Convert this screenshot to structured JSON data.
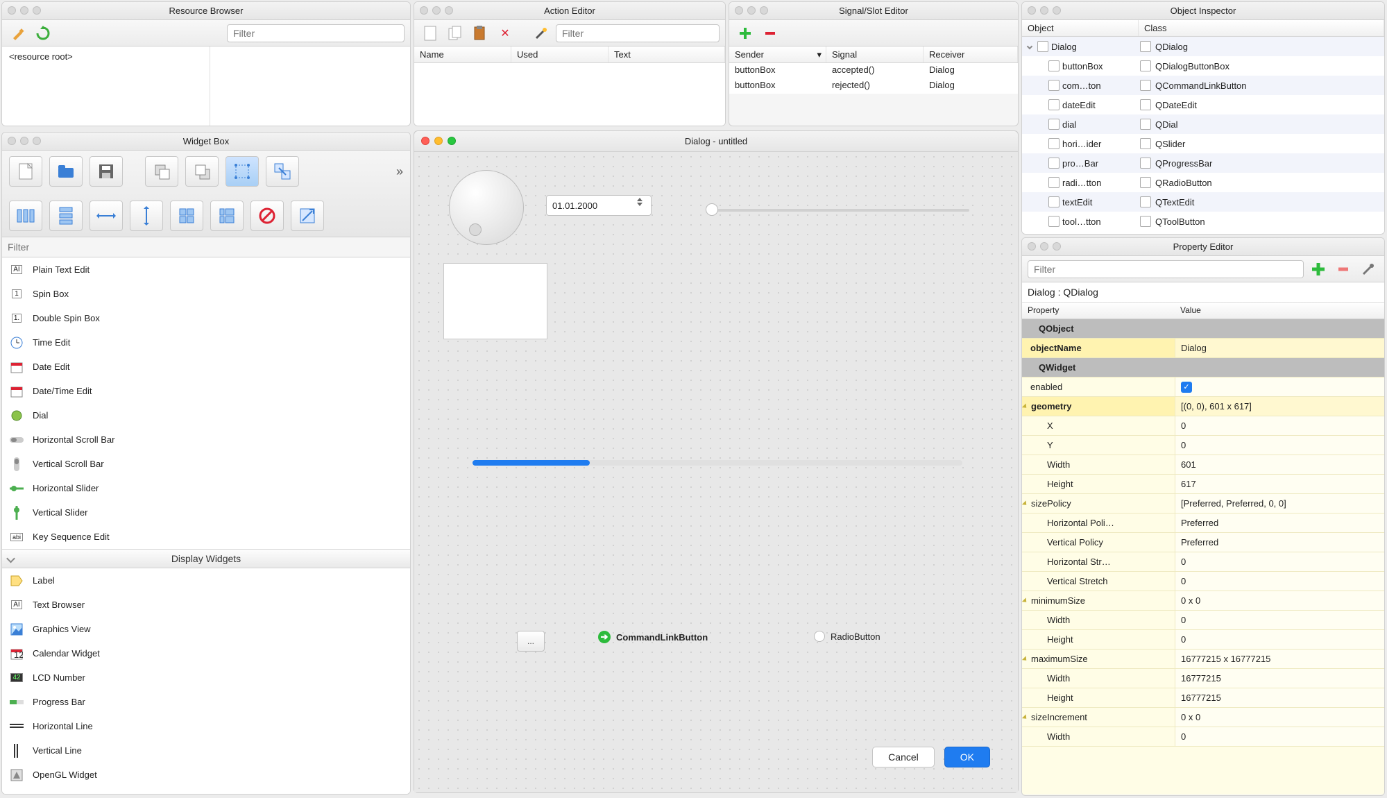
{
  "resourceBrowser": {
    "title": "Resource Browser",
    "filterPlaceholder": "Filter",
    "root": "<resource root>"
  },
  "widgetBox": {
    "title": "Widget Box",
    "filterPlaceholder": "Filter",
    "items": [
      {
        "icon": "[AI]",
        "label": "Plain Text Edit"
      },
      {
        "icon": "[1]",
        "label": "Spin Box"
      },
      {
        "icon": "[1.]",
        "label": "Double Spin Box"
      },
      {
        "icon": "clock",
        "label": "Time Edit"
      },
      {
        "icon": "cal",
        "label": "Date Edit"
      },
      {
        "icon": "cal",
        "label": "Date/Time Edit"
      },
      {
        "icon": "dial",
        "label": "Dial"
      },
      {
        "icon": "hscroll",
        "label": "Horizontal Scroll Bar"
      },
      {
        "icon": "vscroll",
        "label": "Vertical Scroll Bar"
      },
      {
        "icon": "hslider",
        "label": "Horizontal Slider"
      },
      {
        "icon": "vslider",
        "label": "Vertical Slider"
      },
      {
        "icon": "key",
        "label": "Key Sequence Edit"
      }
    ],
    "section2": "Display Widgets",
    "items2": [
      {
        "icon": "label",
        "label": "Label"
      },
      {
        "icon": "[AI]",
        "label": "Text Browser"
      },
      {
        "icon": "gfx",
        "label": "Graphics View"
      },
      {
        "icon": "cal12",
        "label": "Calendar Widget"
      },
      {
        "icon": "lcd",
        "label": "LCD Number"
      },
      {
        "icon": "prog",
        "label": "Progress Bar"
      },
      {
        "icon": "hline",
        "label": "Horizontal Line"
      },
      {
        "icon": "vline",
        "label": "Vertical Line"
      },
      {
        "icon": "ogl",
        "label": "OpenGL Widget"
      }
    ]
  },
  "actionEditor": {
    "title": "Action Editor",
    "filterPlaceholder": "Filter",
    "cols": [
      "Name",
      "Used",
      "Text"
    ]
  },
  "signalEditor": {
    "title": "Signal/Slot Editor",
    "cols": [
      "Sender",
      "Signal",
      "Receiver"
    ],
    "rows": [
      {
        "sender": "buttonBox",
        "signal": "accepted()",
        "receiver": "Dialog"
      },
      {
        "sender": "buttonBox",
        "signal": "rejected()",
        "receiver": "Dialog"
      }
    ]
  },
  "objectInspector": {
    "title": "Object Inspector",
    "cols": [
      "Object",
      "Class"
    ],
    "tree": [
      {
        "indent": 0,
        "object": "Dialog",
        "class": "QDialog",
        "expand": true
      },
      {
        "indent": 1,
        "object": "buttonBox",
        "class": "QDialogButtonBox"
      },
      {
        "indent": 1,
        "object": "com…ton",
        "class": "QCommandLinkButton"
      },
      {
        "indent": 1,
        "object": "dateEdit",
        "class": "QDateEdit"
      },
      {
        "indent": 1,
        "object": "dial",
        "class": "QDial"
      },
      {
        "indent": 1,
        "object": "hori…ider",
        "class": "QSlider"
      },
      {
        "indent": 1,
        "object": "pro…Bar",
        "class": "QProgressBar"
      },
      {
        "indent": 1,
        "object": "radi…tton",
        "class": "QRadioButton"
      },
      {
        "indent": 1,
        "object": "textEdit",
        "class": "QTextEdit"
      },
      {
        "indent": 1,
        "object": "tool…tton",
        "class": "QToolButton"
      }
    ]
  },
  "propertyEditor": {
    "title": "Property Editor",
    "filterPlaceholder": "Filter",
    "context": "Dialog : QDialog",
    "cols": [
      "Property",
      "Value"
    ],
    "rows": [
      {
        "type": "group",
        "name": "QObject"
      },
      {
        "name": "objectName",
        "value": "Dialog",
        "bold": true,
        "edited": true
      },
      {
        "type": "group",
        "name": "QWidget"
      },
      {
        "name": "enabled",
        "value": "check"
      },
      {
        "name": "geometry",
        "value": "[(0, 0), 601 x 617]",
        "bold": true,
        "exp": true,
        "edited": true
      },
      {
        "name": "X",
        "value": "0",
        "child": true
      },
      {
        "name": "Y",
        "value": "0",
        "child": true
      },
      {
        "name": "Width",
        "value": "601",
        "child": true
      },
      {
        "name": "Height",
        "value": "617",
        "child": true
      },
      {
        "name": "sizePolicy",
        "value": "[Preferred, Preferred, 0, 0]",
        "exp": true
      },
      {
        "name": "Horizontal Poli…",
        "value": "Preferred",
        "child": true
      },
      {
        "name": "Vertical Policy",
        "value": "Preferred",
        "child": true
      },
      {
        "name": "Horizontal Str…",
        "value": "0",
        "child": true
      },
      {
        "name": "Vertical Stretch",
        "value": "0",
        "child": true
      },
      {
        "name": "minimumSize",
        "value": "0 x 0",
        "exp": true
      },
      {
        "name": "Width",
        "value": "0",
        "child": true
      },
      {
        "name": "Height",
        "value": "0",
        "child": true
      },
      {
        "name": "maximumSize",
        "value": "16777215 x 16777215",
        "exp": true
      },
      {
        "name": "Width",
        "value": "16777215",
        "child": true
      },
      {
        "name": "Height",
        "value": "16777215",
        "child": true
      },
      {
        "name": "sizeIncrement",
        "value": "0 x 0",
        "exp": true
      },
      {
        "name": "Width",
        "value": "0",
        "child": true
      }
    ]
  },
  "form": {
    "title": "Dialog - untitled",
    "dateValue": "01.01.2000",
    "toolButton": "...",
    "commandLink": "CommandLinkButton",
    "radio": "RadioButton",
    "cancel": "Cancel",
    "ok": "OK",
    "progressPercent": 24
  }
}
